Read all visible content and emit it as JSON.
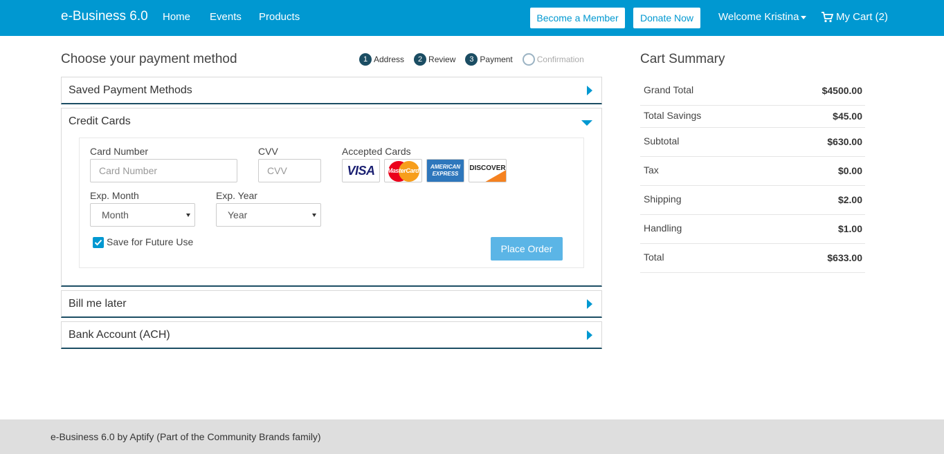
{
  "nav": {
    "brand": "e-Business 6.0",
    "links": [
      "Home",
      "Events",
      "Products"
    ],
    "become_member": "Become a Member",
    "donate": "Donate Now",
    "welcome": "Welcome Kristina",
    "cart": "My Cart (2)"
  },
  "page": {
    "title": "Choose your payment method",
    "steps": [
      {
        "num": "1",
        "label": "Address"
      },
      {
        "num": "2",
        "label": "Review"
      },
      {
        "num": "3",
        "label": "Payment"
      },
      {
        "num": "",
        "label": "Confirmation"
      }
    ]
  },
  "payment": {
    "saved_methods": "Saved Payment Methods",
    "credit_cards": "Credit Cards",
    "bill_later": "Bill me later",
    "bank_account": "Bank Account (ACH)",
    "card_number_label": "Card Number",
    "card_number_placeholder": "Card Number",
    "cvv_label": "CVV",
    "cvv_placeholder": "CVV",
    "accepted_cards_label": "Accepted Cards",
    "cards": [
      "VISA",
      "MasterCard",
      "AMERICAN EXPRESS",
      "DISCOVER"
    ],
    "exp_month_label": "Exp. Month",
    "exp_month_value": "Month",
    "exp_year_label": "Exp. Year",
    "exp_year_value": "Year",
    "save_future": "Save for Future Use",
    "place_order": "Place Order"
  },
  "cart_summary": {
    "title": "Cart Summary",
    "rows": [
      {
        "label": "Grand Total",
        "value": "$4500.00"
      },
      {
        "label": "Total Savings",
        "value": "$45.00"
      },
      {
        "label": "Subtotal",
        "value": "$630.00"
      },
      {
        "label": "Tax",
        "value": "$0.00"
      },
      {
        "label": "Shipping",
        "value": "$2.00"
      },
      {
        "label": "Handling",
        "value": "$1.00"
      },
      {
        "label": "Total",
        "value": "$633.00"
      }
    ]
  },
  "footer": {
    "text": "e-Business 6.0 by Aptify (Part of the Community Brands family)"
  },
  "colors": {
    "navbar": "#0098d1",
    "step": "#1b4d63",
    "button": "#5bb5e6"
  }
}
